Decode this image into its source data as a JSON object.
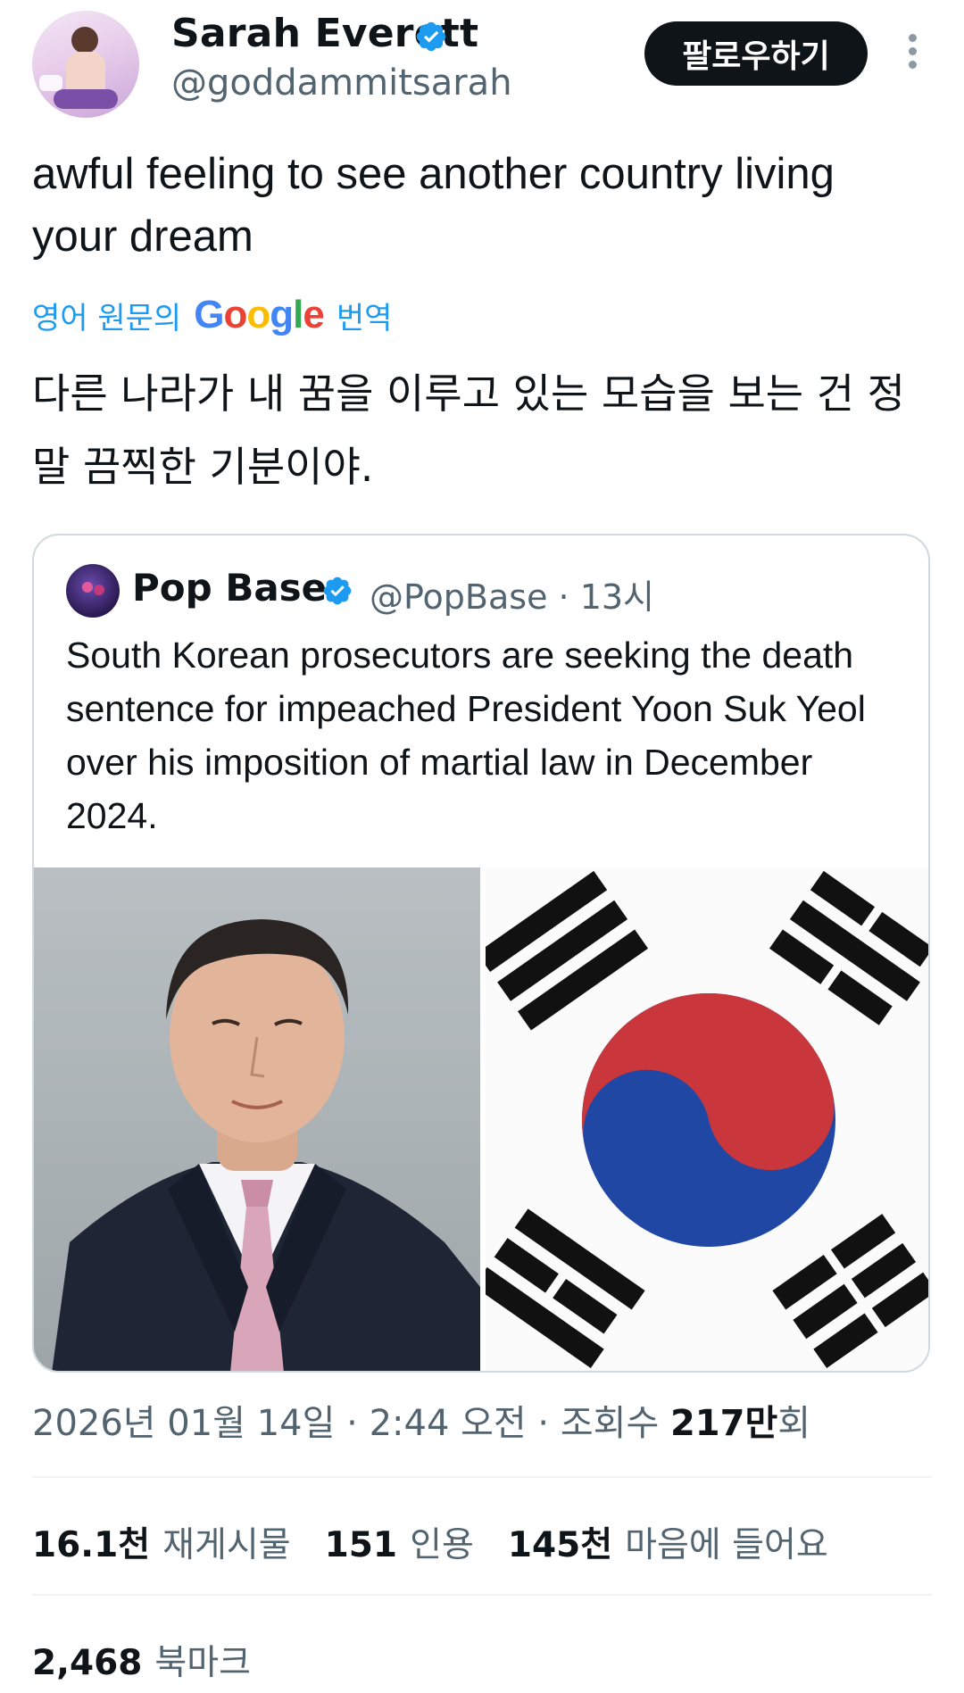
{
  "author": {
    "display_name": "Sarah Everett",
    "handle": "@goddammitsarah",
    "verified_icon": "verified-badge-icon",
    "follow_label": "팔로우하기"
  },
  "tweet": {
    "text": "awful feeling to see another country living your dream",
    "translate_prefix": "영어 원문의",
    "translate_brand": "Google",
    "translate_suffix": "번역",
    "translated_text": "다른 나라가 내 꿈을 이루고 있는 모습을 보는 건 정말 끔찍한 기분이야."
  },
  "quote": {
    "display_name": "Pop Base",
    "handle_time": "@PopBase · 13시",
    "text": "South Korean prosecutors are seeking the death sentence for impeached President Yoon Suk Yeol over his imposition of martial law in December 2024."
  },
  "meta": {
    "timestamp": "2026년 01월 14일 · 2:44 오전 · 조회수 ",
    "views_number": "217만",
    "views_suffix": "회"
  },
  "stats": {
    "reposts_count": "16.1천",
    "reposts_label": "재게시물",
    "quotes_count": "151",
    "quotes_label": "인용",
    "likes_count": "145천",
    "likes_label": "마음에 들어요",
    "bookmarks_count": "2,468",
    "bookmarks_label": "북마크"
  },
  "colors": {
    "link_blue": "#1d9bf0",
    "secondary_text": "#536471",
    "flag_red": "#c9373c",
    "flag_blue": "#1f47a3"
  }
}
